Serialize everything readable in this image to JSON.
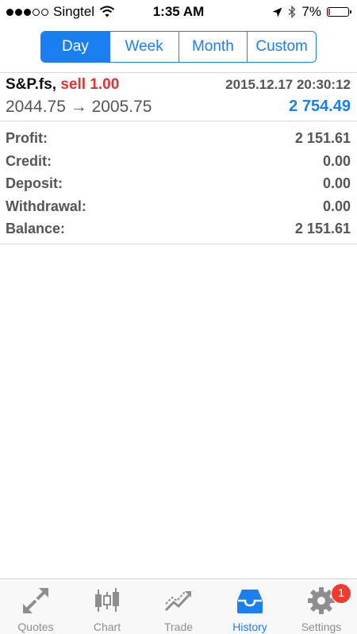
{
  "status_bar": {
    "carrier": "Singtel",
    "time": "1:35 AM",
    "battery": "7%",
    "signal_bars_filled": 3,
    "signal_bars_total": 5
  },
  "period_tabs": [
    "Day",
    "Week",
    "Month",
    "Custom"
  ],
  "selected_period": "Day",
  "deal": {
    "symbol": "S&P.fs,",
    "side": "sell 1.00",
    "datetime": "2015.12.17 20:30:12",
    "prices": "2044.75 → 2005.75",
    "amount": "2 754.49"
  },
  "summary": [
    {
      "label": "Profit:",
      "value": "2 151.61"
    },
    {
      "label": "Credit:",
      "value": "0.00"
    },
    {
      "label": "Deposit:",
      "value": "0.00"
    },
    {
      "label": "Withdrawal:",
      "value": "0.00"
    },
    {
      "label": "Balance:",
      "value": "2 151.61"
    }
  ],
  "tabbar": [
    {
      "label": "Quotes",
      "icon": "quotes-icon"
    },
    {
      "label": "Chart",
      "icon": "chart-icon"
    },
    {
      "label": "Trade",
      "icon": "trade-icon"
    },
    {
      "label": "History",
      "icon": "history-icon"
    },
    {
      "label": "Settings",
      "icon": "gear-icon"
    }
  ],
  "active_tab": "History",
  "settings_badge": "1",
  "colors": {
    "accent": "#1a7ff0",
    "sell": "#e0332e",
    "badge": "#f23b2d"
  }
}
